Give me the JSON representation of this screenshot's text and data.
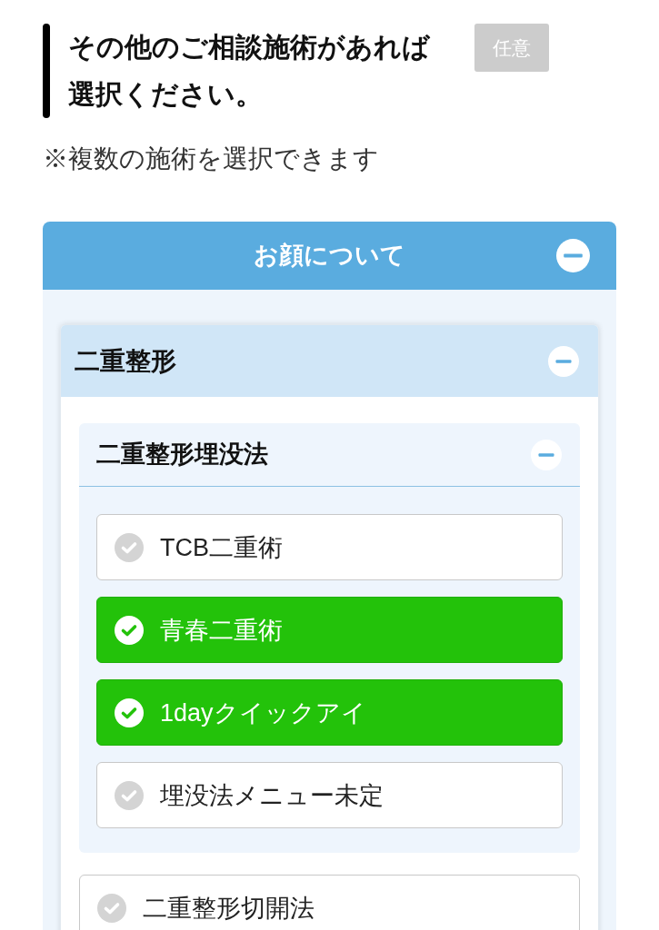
{
  "heading": {
    "title": "その他のご相談施術があれば選択ください。",
    "badge": "任意"
  },
  "note": "※複数の施術を選択できます",
  "categories": [
    {
      "title": "お顔について",
      "expanded": true,
      "groups": [
        {
          "title": "二重整形",
          "expanded": true,
          "items": [
            {
              "kind": "group",
              "title": "二重整形埋没法",
              "expanded": true,
              "options": [
                {
                  "label": "TCB二重術",
                  "selected": false
                },
                {
                  "label": "青春二重術",
                  "selected": true
                },
                {
                  "label": "1dayクイックアイ",
                  "selected": true
                },
                {
                  "label": "埋没法メニュー未定",
                  "selected": false
                }
              ]
            },
            {
              "kind": "option",
              "label": "二重整形切開法",
              "selected": false
            }
          ]
        }
      ]
    }
  ]
}
